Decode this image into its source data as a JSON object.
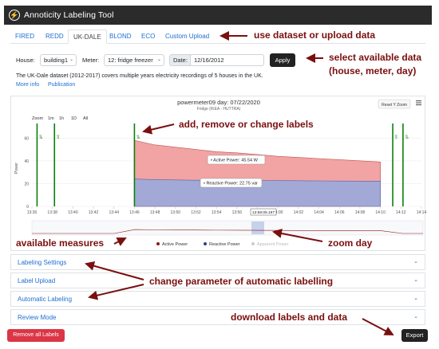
{
  "app": {
    "title": "Annoticity Labeling Tool"
  },
  "datasets": {
    "tabs": [
      "FIRED",
      "REDD",
      "UK-DALE",
      "BLOND",
      "ECO",
      "Custom Upload"
    ],
    "active_index": 2
  },
  "controls": {
    "house_label": "House:",
    "house_value": "building1",
    "meter_label": "Meter:",
    "meter_value": "12: fridge freezer",
    "date_label": "Date:",
    "date_value": "12/16/2012",
    "apply_label": "Apply"
  },
  "dataset_info": {
    "description": "The UK-Dale dataset (2012-2017) covers multiple years electricity recordings of 5 houses in the UK.",
    "more_info_label": "More info",
    "publication_label": "Publication"
  },
  "chart": {
    "title": "powermeter09 day: 07/22/2020",
    "subtitle": "Fridge (IKEA - HUTTRA)",
    "reset_zoom_label": "Reset Y Zoom",
    "menu_icon": "hamburger-icon",
    "zoom_label": "Zoom",
    "zoom_options": [
      "1m",
      "1h",
      "1D",
      "All"
    ],
    "tooltip_active": "• Active Power: 45.54 W",
    "tooltip_reactive": "• Reactive Power: 22.75 var",
    "crosshair_label": "13:58:09.197",
    "ylabel": "Power",
    "label_tags": [
      "off",
      "on",
      "off",
      "on",
      "off",
      "on"
    ],
    "legend": [
      "Active Power",
      "Reactive Power",
      "Apparent Power"
    ],
    "colors": {
      "active": "#f2a3a3",
      "reactive": "#a3a9d6",
      "label_line": "#0a7f0a",
      "active_dot": "#8b1a1a",
      "reactive_dot": "#2c3e8f",
      "apparent_dot": "#cccccc"
    }
  },
  "chart_data": {
    "type": "area",
    "x": [
      "13:36",
      "13:38",
      "13:40",
      "13:42",
      "13:44",
      "13:46",
      "13:48",
      "13:50",
      "13:52",
      "13:54",
      "13:56",
      "13:58",
      "14:00",
      "14:02",
      "14:04",
      "14:06",
      "14:08",
      "14:10",
      "14:12",
      "14:14"
    ],
    "series": [
      {
        "name": "Active Power",
        "values": [
          0,
          0,
          0,
          0,
          0,
          58,
          54,
          52,
          50,
          48,
          47,
          45.54,
          44,
          43,
          42,
          41,
          40,
          39,
          0,
          0
        ]
      },
      {
        "name": "Reactive Power",
        "values": [
          0,
          0,
          0,
          0,
          0,
          24,
          23.5,
          23.2,
          23,
          22.9,
          22.8,
          22.75,
          22.6,
          22.5,
          22.4,
          22.3,
          22.2,
          22.1,
          0,
          0
        ]
      }
    ],
    "yticks": [
      0,
      20,
      40,
      60
    ],
    "ylim": [
      0,
      70
    ],
    "ylabel": "Power"
  },
  "accordion": [
    {
      "label": "Labeling Settings"
    },
    {
      "label": "Label Upload"
    },
    {
      "label": "Automatic Labeling"
    },
    {
      "label": "Review Mode"
    }
  ],
  "footer": {
    "remove_label": "Remove all Labels",
    "export_label": "Export"
  },
  "annotations": {
    "dataset": "use dataset or upload data",
    "select_line1": "select available data",
    "select_line2": "(house, meter, day)",
    "labels": "add, remove or change labels",
    "measures": "available measures",
    "zoom": "zoom day",
    "auto": "change parameter of automatic labelling",
    "download": "download labels and data"
  }
}
